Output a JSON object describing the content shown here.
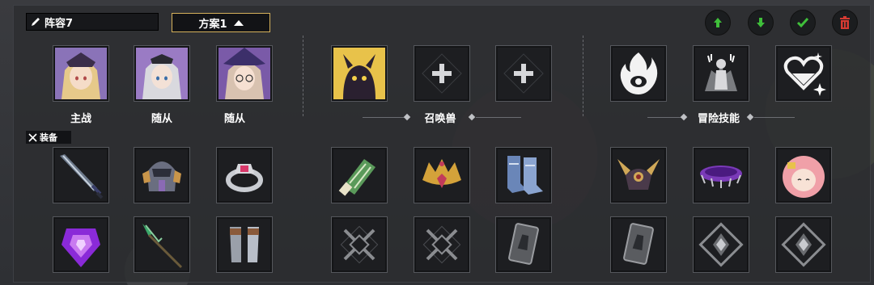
{
  "header": {
    "team_name": "阵容7",
    "plan_label": "方案1",
    "buttons": [
      "move-up",
      "move-down",
      "confirm",
      "delete"
    ]
  },
  "labels": {
    "main": "主战",
    "follower1": "随从",
    "follower2": "随从",
    "summon": "召唤兽",
    "adventure_skill": "冒险技能",
    "equipment": "装备"
  },
  "colors": {
    "up_down_green": "#3fbf3a",
    "confirm_green": "#3fbf3a",
    "delete_red": "#d63a32",
    "plan_border": "#d6b25b"
  },
  "slots": {
    "characters": [
      "blonde-girl-portrait",
      "silver-hair-girl-portrait",
      "mage-girl-portrait"
    ],
    "summons": [
      "dark-creature-portrait",
      "empty-add-slot",
      "empty-add-slot"
    ],
    "skills": [
      "eye-flame-icon",
      "warrior-skill-icon",
      "heart-sparkle-icon"
    ],
    "equip_row1": [
      "sword",
      "helmet-armor",
      "jeweled-ring",
      "green-bracer",
      "golden-crown",
      "blue-boots",
      "horned-helm",
      "purple-belt",
      "pink-hair-girl-portrait"
    ],
    "equip_row2": [
      "purple-gem-shield",
      "green-spear",
      "gauntlets",
      "empty-crossed-weapons",
      "empty-crossed-weapons",
      "empty-card",
      "empty-card",
      "empty-emblem",
      "empty-emblem"
    ]
  }
}
